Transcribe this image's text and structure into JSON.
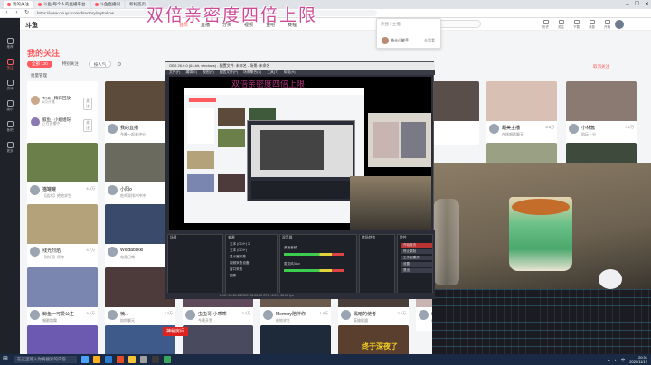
{
  "browser": {
    "tabs": [
      {
        "label": "我的关注",
        "active": true
      },
      {
        "label": "斗鱼-每个人的直播平台",
        "active": false
      },
      {
        "label": "斗鱼直播间",
        "active": false
      },
      {
        "label": "新标签页",
        "active": false
      }
    ],
    "url": "https://www.douyu.com/directory/myFollow",
    "controls": {
      "minimize": "–",
      "maximize": "☐",
      "close": "✕"
    }
  },
  "site": {
    "logo": "斗鱼",
    "nav": [
      "首页",
      "直播",
      "分类",
      "视频",
      "鱼吧",
      "赛程"
    ],
    "search_placeholder": "搜索主播/直播",
    "header_icons": [
      "历史",
      "关注",
      "下载",
      "消息",
      "开播"
    ]
  },
  "popup": {
    "header": "热搜 / 主播",
    "name": "抽卡小能手",
    "button": "去看看"
  },
  "sidebar": [
    "推荐",
    "关注",
    "游戏",
    "娱乐",
    "鱼吧",
    "更多"
  ],
  "page": {
    "title": "我的关注",
    "filters": [
      {
        "label": "全部",
        "count": "120",
        "active": true
      },
      {
        "label": "特别关注"
      },
      {
        "label": "按人气"
      }
    ],
    "manage": "批量管理",
    "right_link": "取消关注"
  },
  "follows": [
    {
      "name": "TAG · 精彩回放",
      "sub": "6月开播",
      "btn": "关注"
    },
    {
      "name": "鲸鱼 · 小姐姐呀",
      "sub": "正在直播中",
      "btn": "关注"
    }
  ],
  "cards_row1": [
    {
      "name": "我的直播",
      "sub": "今晚一起来冲分",
      "heat": "1.2万",
      "thumb": "#5c4a3a"
    },
    {
      "name": "",
      "sub": "",
      "heat": "",
      "thumb": "#3f5a3a"
    },
    {
      "name": "",
      "sub": "",
      "heat": "",
      "thumb": "#5a4e4a"
    },
    {
      "name": "甜美主播",
      "sub": "在线唱歌聊天",
      "heat": "8.6万",
      "thumb": "#d8c0b4"
    },
    {
      "name": "小林酱",
      "sub": "陪玩上分",
      "heat": "3.1万",
      "thumb": "#8a7a72"
    }
  ],
  "cards_row2": [
    {
      "name": "猫罐罐",
      "sub": "【战术】绝地求生",
      "heat": "6.9万",
      "thumb": "#6a7f4a"
    },
    {
      "name": "小阳o",
      "sub": "吃鸡双排冲冲冲",
      "heat": "2.4万",
      "thumb": "#6b6a5e"
    },
    {
      "name": "Fiony悦悦子",
      "sub": "今日份营业",
      "heat": "13.8万",
      "thumb": "#9aa084"
    },
    {
      "name": "小锅锅",
      "sub": "深夜吃鸡",
      "heat": "5.0万",
      "thumb": "#3e4a3c"
    }
  ],
  "cards_row3": [
    {
      "name": "残光烈焰",
      "sub": "【热门】原神",
      "heat": "4.7万",
      "thumb": "#b4a27a"
    },
    {
      "name": "Wisdaoskki",
      "sub": "电竞日常",
      "heat": "1.5万",
      "thumb": "#3a4a6a"
    }
  ],
  "cards_row4": [
    {
      "name": "鲸鱼一可爱公主",
      "sub": "唱歌跳舞",
      "heat": "9.9万",
      "thumb": "#7a86b0"
    },
    {
      "name": "楠...",
      "sub": "陪你聊天",
      "heat": "2.2万",
      "thumb": "#4d3a3a"
    },
    {
      "name": "虫虫哥-小乖乖",
      "sub": "今晚开黑",
      "heat": "3.3万",
      "thumb": "#5e4a5a"
    },
    {
      "name": "Memory陪伴你",
      "sub": "绝地求生",
      "heat": "1.8万",
      "thumb": "#6a5a4e"
    },
    {
      "name": "黑暗的使者",
      "sub": "英雄联盟",
      "heat": "2.0万",
      "thumb": "#4a3e3a"
    },
    {
      "name": "萌宠",
      "sub": "在线互动",
      "heat": "1.1万",
      "thumb": "#c8b4b0"
    }
  ],
  "cards_row5": [
    {
      "thumb": "#6c5ab0"
    },
    {
      "thumb": "#3e5a8a"
    },
    {
      "thumb": "#4a4a5e"
    },
    {
      "thumb": "#1e2a3a"
    },
    {
      "thumb": "#5a3e2e"
    }
  ],
  "obs": {
    "title": "OBS 26.0.0 (64-bit, windows) - 配置文件: 未命名 - 场景: 未命名",
    "menu": [
      "文件(F)",
      "编辑(E)",
      "视图(V)",
      "配置文件(P)",
      "场景集合(S)",
      "工具(T)",
      "帮助(H)"
    ],
    "docks": {
      "scenes": "场景",
      "sources": "来源",
      "mixer": "混音器",
      "transitions": "转场特效",
      "controls": "控件"
    },
    "sources": [
      "文本 (GDI+) 2",
      "文本 (GDI+)",
      "显示器采集",
      "视频采集设备",
      "窗口采集",
      "图像"
    ],
    "mixer": [
      "桌面音频",
      "麦克风/Aux"
    ],
    "controls": [
      "开始推流",
      "停止录制",
      "工作室模式",
      "设置",
      "退出"
    ],
    "status": "LIVE: 00:12:45   REC: 00:00:00   CPU: 6.2%, 30.00 fps"
  },
  "overlay": {
    "banner": "双倍亲密度四倍上限",
    "banner_small": "双倍亲密度四倍上限",
    "banner_red": "神秘房间",
    "banner_yellow": "终于深夜了"
  },
  "taskbar": {
    "search": "在这里输入你要搜索的内容",
    "apps": [
      "#4aa3ff",
      "#ffb020",
      "#2b7cd3",
      "#e34c26",
      "#f6c23b",
      "#a0a0a0",
      "#3a3a3a",
      "#3aa55c"
    ],
    "clock_time": "20:31",
    "clock_date": "2020/11/12",
    "lang": "中"
  },
  "colors": {
    "accent": "#ff5a5f",
    "sidebar": "#1f2329",
    "taskbar": "#1a2a44",
    "banner": "#c93a8e"
  }
}
